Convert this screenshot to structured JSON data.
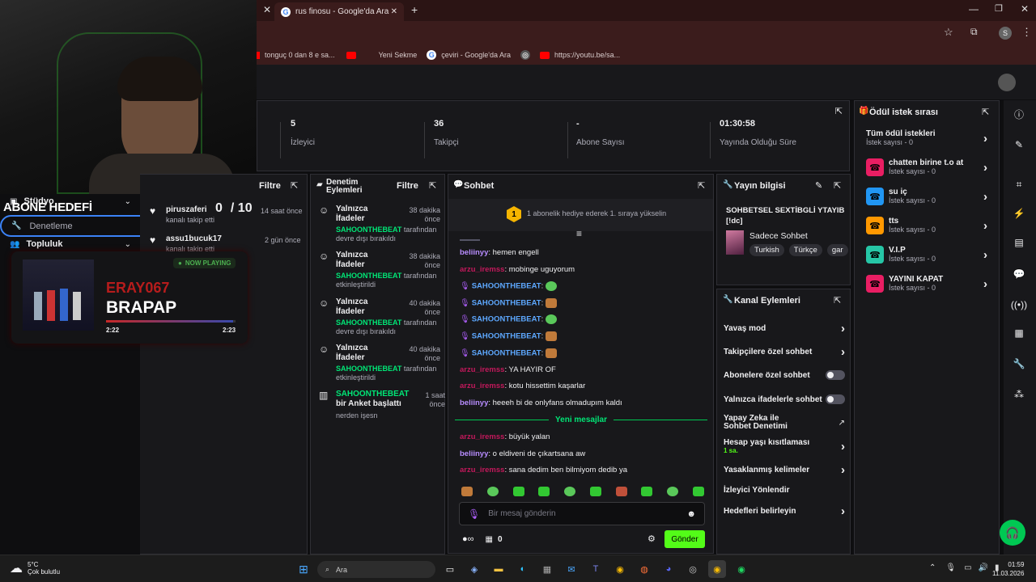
{
  "browser": {
    "tab_title": "rus finosu - Google'da Ara",
    "bookmarks": [
      "tonguç 0 dan 8 e sa...",
      "Yeni Sekme",
      "çeviri - Google'da Ara",
      "https://youtu.be/sa..."
    ]
  },
  "stats": [
    {
      "value": "5",
      "label": "İzleyici"
    },
    {
      "value": "36",
      "label": "Takipçi"
    },
    {
      "value": "-",
      "label": "Abone Sayısı"
    },
    {
      "value": "01:30:58",
      "label": "Yayında Olduğu Süre"
    }
  ],
  "overlay": {
    "abone_hedefi": "ABONE HEDEFİ",
    "goal_current": "0",
    "goal_total": "/ 10",
    "now_playing": "NOW PLAYING",
    "artist": "ERAY067",
    "song": "BRAPAP",
    "progress_fraction": 0.98,
    "time_elapsed": "2:22",
    "time_total": "2:23"
  },
  "leftmenu": {
    "studio": "Stüdyo",
    "denetleme": "Denetleme",
    "topluluk": "Topluluk"
  },
  "followers": {
    "filter": "Filtre",
    "items": [
      {
        "name": "piruszaferi",
        "sub": "kanalı takip etti",
        "time": "14 saat önce"
      },
      {
        "name": "assu1bucuk17",
        "sub": "kanalı takip etti",
        "time": "2 gün önce"
      }
    ]
  },
  "moderation": {
    "title": "Denetim Eylemleri",
    "filter": "Filtre",
    "items": [
      {
        "title": "Yalnızca İfadeler",
        "time": "38 dakika önce",
        "actor": "SAHOONTHEBEAT",
        "desc": "tarafından devre dışı bırakıldı"
      },
      {
        "title": "Yalnızca İfadeler",
        "time": "38 dakika önce",
        "actor": "SAHOONTHEBEAT",
        "desc": "tarafından etkinleştirildi"
      },
      {
        "title": "Yalnızca İfadeler",
        "time": "40 dakika önce",
        "actor": "SAHOONTHEBEAT",
        "desc": "tarafından devre dışı bırakıldı"
      },
      {
        "title": "Yalnızca İfadeler",
        "time": "40 dakika önce",
        "actor": "SAHOONTHEBEAT",
        "desc": "tarafından etkinleştirildi"
      }
    ],
    "poll": {
      "actor": "SAHOONTHEBEAT",
      "text": "bir Anket başlattı",
      "sub": "nerden işesn",
      "time": "1 saat önce"
    }
  },
  "chat": {
    "title": "Sohbet",
    "rank": "1",
    "banner": "1 abonelik hediye ederek 1. sıraya yükselin",
    "messages": [
      {
        "user": "beliinyy",
        "text": ": hemen engell",
        "cls": "un-p"
      },
      {
        "user": "arzu_iremss",
        "text": ": mobinge uguyorum",
        "cls": "un-r"
      },
      {
        "user": "SAHOONTHEBEAT",
        "text": ":",
        "cls": "un-b"
      },
      {
        "user": "SAHOONTHEBEAT",
        "text": ":",
        "cls": "un-b"
      },
      {
        "user": "SAHOONTHEBEAT",
        "text": ":",
        "cls": "un-b"
      },
      {
        "user": "SAHOONTHEBEAT",
        "text": ":",
        "cls": "un-b"
      },
      {
        "user": "SAHOONTHEBEAT",
        "text": ":",
        "cls": "un-b"
      },
      {
        "user": "arzu_iremss",
        "text": ": YA HAYIR OF",
        "cls": "un-r"
      },
      {
        "user": "arzu_iremss",
        "text": ": kotu hissettim kaşarlar",
        "cls": "un-r"
      },
      {
        "user": "beliinyy",
        "text": ": heeeh bi de onlyfans olmadupım kaldı",
        "cls": "un-p"
      }
    ],
    "new_messages": "Yeni mesajlar",
    "messages_after": [
      {
        "user": "arzu_iremss",
        "text": ": büyük yalan",
        "cls": "un-r"
      },
      {
        "user": "beliinyy",
        "text": ": o eldiveni de çıkartsana aw",
        "cls": "un-p"
      },
      {
        "user": "arzu_iremss",
        "text": ": sana dedim ben bilmiyom dedib ya",
        "cls": "un-r"
      }
    ],
    "placeholder": "Bir mesaj gönderin",
    "points": "0",
    "send": "Gönder"
  },
  "streaminfo": {
    "title": "Yayın bilgisi",
    "stream_title": "SOHBETSEL SEXTİBGLİ YTAYIB [!dc]",
    "category": "Sadece Sohbet",
    "tags": [
      "Turkish",
      "Türkçe",
      "gar"
    ]
  },
  "channel_actions": {
    "title": "Kanal Eylemleri",
    "items": [
      {
        "label": "Yavaş mod",
        "sub": ""
      },
      {
        "label": "Takipçilere özel sohbet",
        "sub": ""
      },
      {
        "label": "Abonelere özel sohbet",
        "sub": ""
      },
      {
        "label": "Yalnızca ifadelerle sohbet",
        "sub": ""
      },
      {
        "label": "Yapay Zeka ile Sohbet Denetimi",
        "sub": ""
      },
      {
        "label": "Hesap yaşı kısıtlaması",
        "sub": "1 sa."
      },
      {
        "label": "Yasaklanmış kelimeler",
        "sub": ""
      },
      {
        "label": "İzleyici Yönlendir",
        "sub": ""
      },
      {
        "label": "Hedefleri belirleyin",
        "sub": ""
      }
    ]
  },
  "rewards": {
    "title": "Ödül istek sırası",
    "all": "Tüm ödül istekleri",
    "all_sub": "İstek sayısı - 0",
    "items": [
      {
        "name": "chatten birine t.o at",
        "sub": "İstek sayısı - 0",
        "color": "#e91e63"
      },
      {
        "name": "su iç",
        "sub": "İstek sayısı - 0",
        "color": "#2196f3"
      },
      {
        "name": "tts",
        "sub": "İstek sayısı - 0",
        "color": "#ff9800"
      },
      {
        "name": "V.I.P",
        "sub": "İstek sayısı - 0",
        "color": "#26c6a6"
      },
      {
        "name": "YAYINI KAPAT",
        "sub": "İstek sayısı - 0",
        "color": "#e91e63"
      }
    ]
  },
  "taskbar": {
    "temp": "5°C",
    "weather": "Çok bulutlu",
    "search": "Ara",
    "time": "01:59",
    "date": "11.03.2026"
  }
}
